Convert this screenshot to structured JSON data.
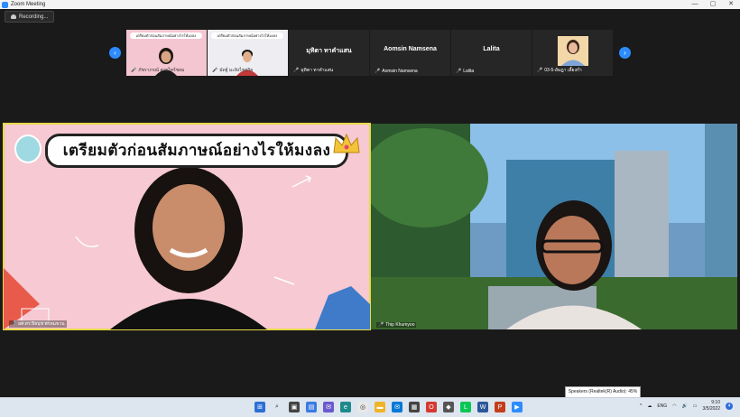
{
  "window": {
    "title": "Zoom Meeting",
    "controls": [
      "—",
      "▢",
      "✕"
    ]
  },
  "recording": {
    "label": "Recording..."
  },
  "banner_text": "เตรียมตัวก่อนสัมภาษณ์อย่างไรให้มงลง",
  "strip": {
    "thumbs": [
      {
        "type": "video",
        "banner": "เตรียมตัวก่อนสัมภาษณ์อย่างไรให้มงลง",
        "name": "ภัชราภรณ์ สายไทร์ชยม"
      },
      {
        "type": "video",
        "banner": "เตรียมตัวก่อนสัมภาษณ์อย่างไรให้มงลง",
        "name": "มัดฐ์ มะลิงไชยกิย"
      },
      {
        "type": "name",
        "display": "มุทิตา ทาคำแสน",
        "name": "มุทิตา ทาคำแสน"
      },
      {
        "type": "name",
        "display": "Aomsin Namsena",
        "name": "Aomsin Namsena"
      },
      {
        "type": "name",
        "display": "Lalita",
        "name": "Lalita"
      },
      {
        "type": "photo",
        "name": "03-5-อัษฎา เลี้ยงก่ำ"
      }
    ]
  },
  "tiles": {
    "left": {
      "name": "ผศ.ดร.ปิยนุช พรหมขวน"
    },
    "right": {
      "name": "Thip Khumyoo"
    }
  },
  "speaker_tooltip": "Speakers (Realtek(R) Audio): 45%",
  "taskbar": {
    "tray": {
      "lang": "ENG",
      "time": "9:10",
      "date": "3/5/2022",
      "notifications": "4"
    }
  }
}
